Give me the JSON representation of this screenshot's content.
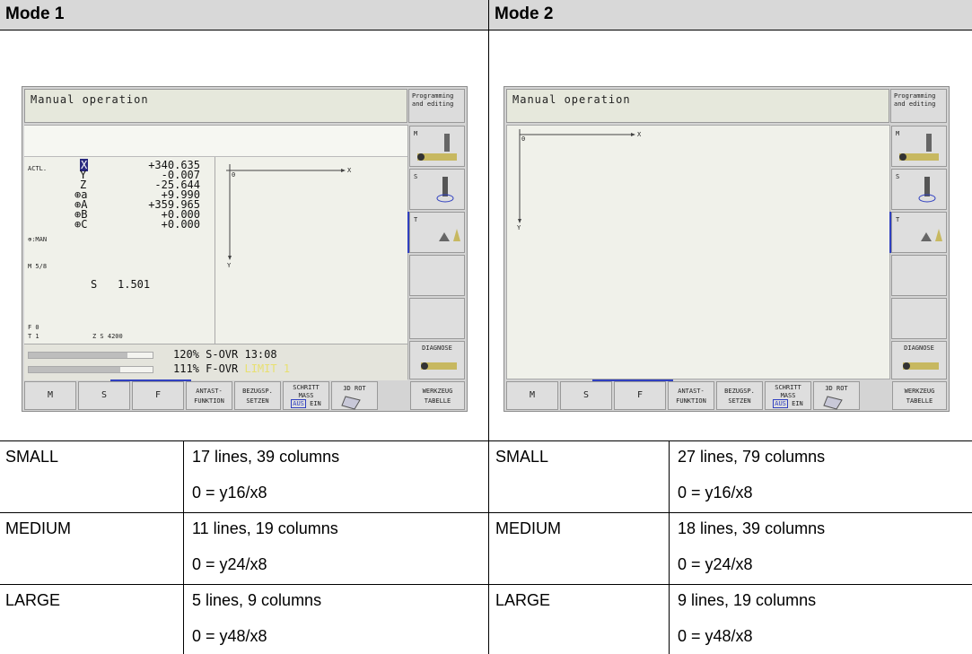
{
  "header": {
    "mode1": "Mode 1",
    "mode2": "Mode 2"
  },
  "screen": {
    "title": "Manual operation",
    "prog_line1": "Programming",
    "prog_line2": "and editing",
    "softkeys_right": [
      "M",
      "S",
      "T",
      "",
      "",
      "DIAGNOSE"
    ],
    "softkeys_bottom": [
      {
        "l1": "M",
        "l2": ""
      },
      {
        "l1": "S",
        "l2": ""
      },
      {
        "l1": "F",
        "l2": ""
      },
      {
        "l1": "ANTAST-",
        "l2": "FUNKTION"
      },
      {
        "l1": "BEZUGSP.",
        "l2": "SETZEN"
      },
      {
        "l1": "SCHRITT",
        "l2": "MASS",
        "l3a": "AUS",
        "l3b": "EIN"
      },
      {
        "l1": "3D ROT",
        "l2": ""
      },
      {
        "l1": "WERKZEUG",
        "l2": "TABELLE"
      }
    ],
    "axis_x": "X",
    "axis_y": "Y",
    "axis_origin": "0"
  },
  "mode1_screen": {
    "actl_label": "ACTL.",
    "man_label": "⊕:MAN",
    "positions": [
      {
        "axis": "X",
        "value": "+340.635"
      },
      {
        "axis": "Y",
        "value": "-0.007"
      },
      {
        "axis": "Z",
        "value": "-25.644"
      },
      {
        "axis": "⊕a",
        "value": "+9.990"
      },
      {
        "axis": "⊕A",
        "value": "+359.965"
      },
      {
        "axis": "⊕B",
        "value": "+0.000"
      },
      {
        "axis": "⊕C",
        "value": "+0.000"
      }
    ],
    "m_label": "M 5/8",
    "s_label": "S",
    "s_value": "1.501",
    "f_label": "F 0",
    "t_label": "T 1",
    "zs_label": "Z S 4200",
    "s_ovr": "120% S-OVR 13:08",
    "f_ovr": "111% F-OVR",
    "limit": "LIMIT 1",
    "s_ovr_fraction": 0.8,
    "f_ovr_fraction": 0.74
  },
  "rows": [
    {
      "m1_size": "SMALL",
      "m1_info": "17 lines, 39 columns",
      "m1_origin": "0 = y16/x8",
      "m2_size": "SMALL",
      "m2_info": "27 lines, 79 columns",
      "m2_origin": "0 = y16/x8"
    },
    {
      "m1_size": "MEDIUM",
      "m1_info": "11 lines, 19 columns",
      "m1_origin": "0 = y24/x8",
      "m2_size": "MEDIUM",
      "m2_info": "18 lines, 39 columns",
      "m2_origin": "0 = y24/x8"
    },
    {
      "m1_size": "LARGE",
      "m1_info": "5 lines, 9 columns",
      "m1_origin": "0 = y48/x8",
      "m2_size": "LARGE",
      "m2_info": "9 lines, 19 columns",
      "m2_origin": "0 = y48/x8"
    }
  ],
  "colors": {
    "header_bg": "#d8d8d8",
    "accent": "#3040c0",
    "limit": "#e8e070"
  }
}
